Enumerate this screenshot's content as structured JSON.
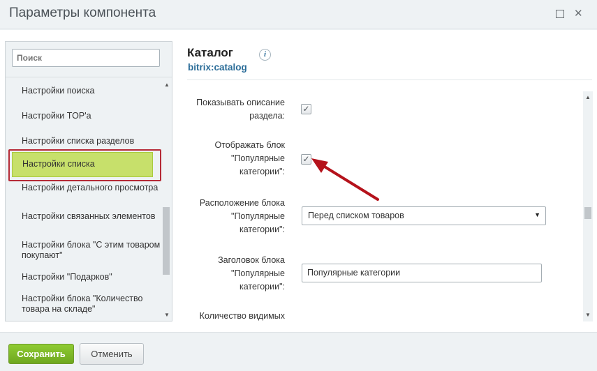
{
  "window": {
    "title": "Параметры компонента"
  },
  "sidebar": {
    "search_placeholder": "Поиск",
    "items": [
      {
        "label": "Настройки поиска"
      },
      {
        "label": "Настройки TOP'а"
      },
      {
        "label": "Настройки списка разделов"
      },
      {
        "label": "Настройки списка",
        "active": true
      },
      {
        "label": "Настройки детального просмотра"
      },
      {
        "label": "Настройки связанных элементов"
      },
      {
        "label": "Настройки блока \"С этим товаром покупают\""
      },
      {
        "label": "Настройки \"Подарков\""
      },
      {
        "label": "Настройки блока \"Количество товара на складе\""
      }
    ]
  },
  "component": {
    "title": "Каталог",
    "code": "bitrix:catalog",
    "info_glyph": "i"
  },
  "form": {
    "show_description": {
      "label": "Показывать описание раздела:",
      "checked": true
    },
    "show_popular_block": {
      "label": "Отображать блок \"Популярные категории\":",
      "checked": true
    },
    "popular_position": {
      "label": "Расположение блока \"Популярные категории\":",
      "value": "Перед списком товаров"
    },
    "popular_title": {
      "label": "Заголовок блока \"Популярные категории\":",
      "value": "Популярные категории"
    },
    "visible_count": {
      "label": "Количество видимых"
    }
  },
  "footer": {
    "save_label": "Сохранить",
    "cancel_label": "Отменить"
  },
  "colors": {
    "active_item": "#c7e06b",
    "highlight_outline": "#b52a36",
    "annotation_arrow": "#b5121b",
    "save_button": "#7ab828",
    "link": "#2a6c98"
  }
}
